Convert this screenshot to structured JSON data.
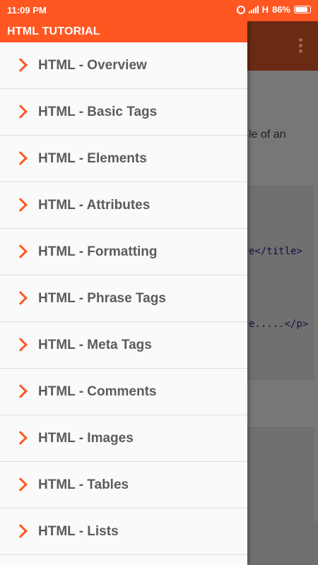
{
  "status_bar": {
    "time": "11:09 PM",
    "network": "H",
    "battery": "86%",
    "battery_level": 0.86
  },
  "drawer": {
    "title": "HTML TUTORIAL",
    "items": [
      {
        "label": "HTML - Overview",
        "icon": "chevron-right-icon"
      },
      {
        "label": "HTML - Basic Tags",
        "icon": "chevron-right-icon"
      },
      {
        "label": "HTML - Elements",
        "icon": "chevron-right-icon"
      },
      {
        "label": "HTML - Attributes",
        "icon": "chevron-right-icon"
      },
      {
        "label": "HTML - Formatting",
        "icon": "chevron-right-icon"
      },
      {
        "label": "HTML - Phrase Tags",
        "icon": "chevron-right-icon"
      },
      {
        "label": "HTML - Meta Tags",
        "icon": "chevron-right-icon"
      },
      {
        "label": "HTML - Comments",
        "icon": "chevron-right-icon"
      },
      {
        "label": "HTML - Images",
        "icon": "chevron-right-icon"
      },
      {
        "label": "HTML - Tables",
        "icon": "chevron-right-icon"
      },
      {
        "label": "HTML - Lists",
        "icon": "chevron-right-icon"
      }
    ]
  },
  "background": {
    "text_fragment": "le of an",
    "code_line_1": "e</title>",
    "code_line_2": "e.....</p>"
  },
  "colors": {
    "accent": "#ff5722",
    "drawer_bg": "#fafafa",
    "item_text": "#5b5b5b",
    "scrim": "#777777"
  }
}
